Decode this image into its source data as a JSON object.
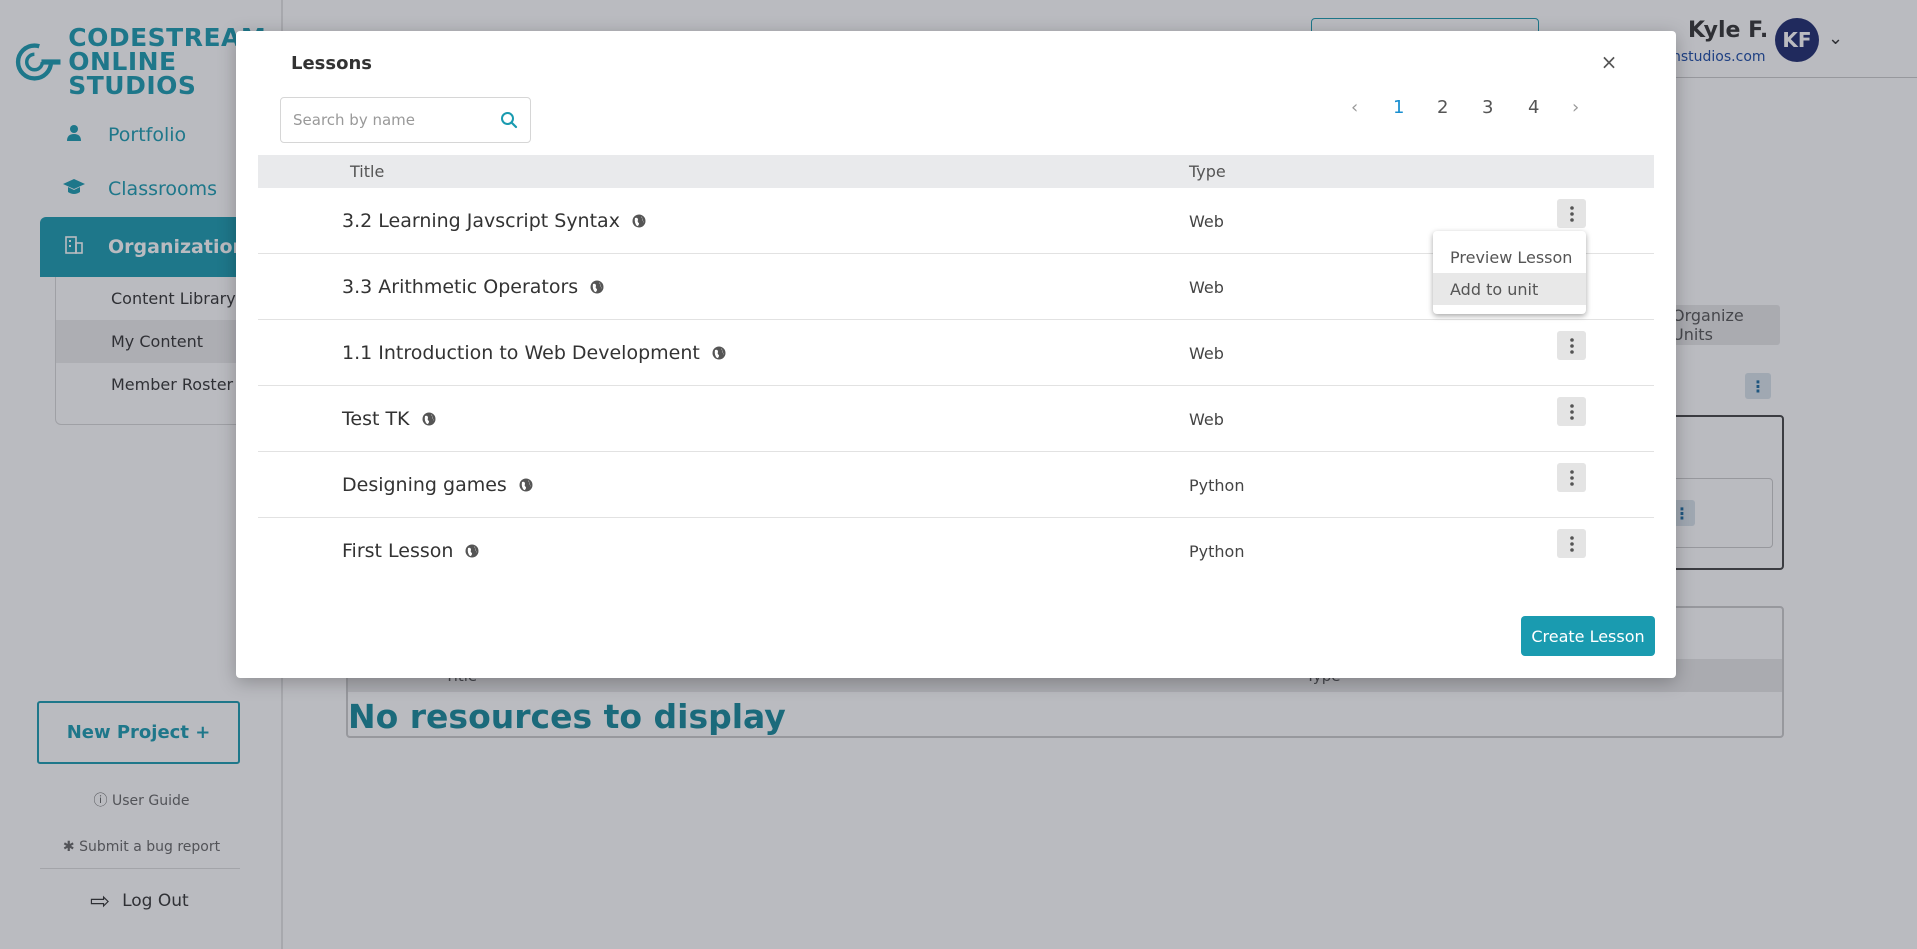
{
  "app": {
    "logo_line1": "CODESTREAM",
    "logo_line2": "ONLINE STUDIOS"
  },
  "sidebar": {
    "items": [
      {
        "label": "Portfolio",
        "icon": "user-icon"
      },
      {
        "label": "Classrooms",
        "icon": "graduation-cap-icon"
      },
      {
        "label": "Organization",
        "icon": "building-icon",
        "active": true
      }
    ],
    "subitems": [
      {
        "label": "Content Library"
      },
      {
        "label": "My Content",
        "selected": true
      },
      {
        "label": "Member Roster"
      }
    ],
    "new_project": "New Project +",
    "user_guide": "User Guide",
    "bug_report": "Submit a bug report",
    "logout": "Log Out"
  },
  "header": {
    "user_name": "Kyle F.",
    "user_email": "nstudios.com",
    "avatar_initials": "KF"
  },
  "background": {
    "organize_units": "Organize Units",
    "table_title_col": "Title",
    "table_type_col": "Type",
    "no_resources": "No resources to display"
  },
  "modal": {
    "title": "Lessons",
    "close_icon": "close-icon",
    "search_placeholder": "Search by name",
    "pagination": {
      "pages": [
        "1",
        "2",
        "3",
        "4"
      ],
      "current": "1"
    },
    "columns": {
      "title": "Title",
      "type": "Type"
    },
    "rows": [
      {
        "title": "3.2 Learning Javscript Syntax",
        "type": "Web"
      },
      {
        "title": "3.3 Arithmetic Operators",
        "type": "Web"
      },
      {
        "title": "1.1 Introduction to Web Development",
        "type": "Web"
      },
      {
        "title": "Test TK",
        "type": "Web"
      },
      {
        "title": "Designing games",
        "type": "Python"
      },
      {
        "title": "First Lesson",
        "type": "Python"
      }
    ],
    "dropdown": {
      "items": [
        "Preview Lesson",
        "Add to unit"
      ],
      "highlighted": "Add to unit"
    },
    "create_button": "Create Lesson"
  },
  "colors": {
    "accent": "#1a9bb0",
    "avatar": "#1c2a6e",
    "page_current": "#1a8fd0"
  }
}
